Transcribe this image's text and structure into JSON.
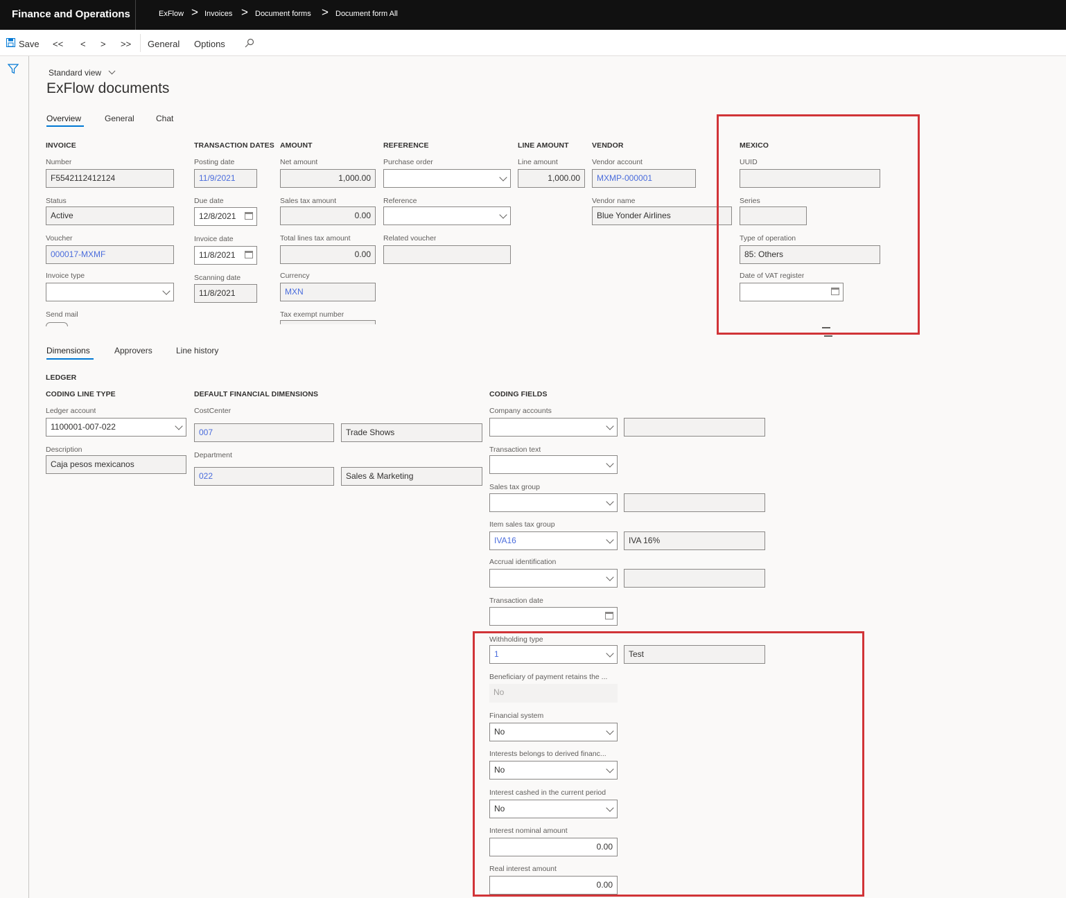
{
  "header": {
    "app_title": "Finance and Operations",
    "breadcrumbs": [
      "ExFlow",
      "Invoices",
      "Document forms",
      "Document form All"
    ],
    "breadcrumb_separator": ">"
  },
  "toolbar": {
    "save": "Save",
    "first": "<<",
    "prev": "<",
    "next": ">",
    "last": ">>",
    "general": "General",
    "options": "Options"
  },
  "page": {
    "view": "Standard view",
    "title": "ExFlow documents"
  },
  "top_tabs": [
    "Overview",
    "General",
    "Chat"
  ],
  "invoice": {
    "heading": "INVOICE",
    "number_label": "Number",
    "number": "F5542112412124",
    "status_label": "Status",
    "status": "Active",
    "voucher_label": "Voucher",
    "voucher": "000017-MXMF",
    "invoice_type_label": "Invoice type",
    "invoice_type": "",
    "send_mail_label": "Send mail"
  },
  "transaction_dates": {
    "heading": "TRANSACTION DATES",
    "posting_label": "Posting date",
    "posting": "11/9/2021",
    "due_label": "Due date",
    "due": "12/8/2021",
    "invoice_label": "Invoice date",
    "invoice": "11/8/2021",
    "scanning_label": "Scanning date",
    "scanning": "11/8/2021"
  },
  "amount": {
    "heading": "AMOUNT",
    "net_label": "Net amount",
    "net": "1,000.00",
    "sales_tax_label": "Sales tax amount",
    "sales_tax": "0.00",
    "total_lines_tax_label": "Total lines tax amount",
    "total_lines_tax": "0.00",
    "currency_label": "Currency",
    "currency": "MXN",
    "tax_exempt_label": "Tax exempt number"
  },
  "reference": {
    "heading": "REFERENCE",
    "po_label": "Purchase order",
    "po": "",
    "ref_label": "Reference",
    "ref": "",
    "related_label": "Related voucher",
    "related": ""
  },
  "line_amount": {
    "heading": "LINE AMOUNT",
    "label": "Line amount",
    "value": "1,000.00"
  },
  "vendor": {
    "heading": "VENDOR",
    "account_label": "Vendor account",
    "account": "MXMP-000001",
    "name_label": "Vendor name",
    "name": "Blue Yonder Airlines"
  },
  "mexico": {
    "heading": "MEXICO",
    "uuid_label": "UUID",
    "uuid": "",
    "series_label": "Series",
    "series": "",
    "type_op_label": "Type of operation",
    "type_op": "85: Others",
    "vat_date_label": "Date of VAT register",
    "vat_date": ""
  },
  "line_tabs": [
    "Dimensions",
    "Approvers",
    "Line history"
  ],
  "ledger": {
    "heading": "LEDGER",
    "coding_line_type": "CODING LINE TYPE",
    "account_label": "Ledger account",
    "account": "1100001-007-022",
    "desc_label": "Description",
    "desc": "Caja pesos mexicanos"
  },
  "dims": {
    "heading": "DEFAULT FINANCIAL DIMENSIONS",
    "cc_label": "CostCenter",
    "cc": "007",
    "cc_name": "Trade Shows",
    "dept_label": "Department",
    "dept": "022",
    "dept_name": "Sales & Marketing"
  },
  "coding": {
    "heading": "CODING FIELDS",
    "company_label": "Company accounts",
    "trans_text_label": "Transaction text",
    "stg_label": "Sales tax group",
    "istg_label": "Item sales tax group",
    "istg": "IVA16",
    "istg_name": "IVA 16%",
    "accrual_label": "Accrual identification",
    "trans_date_label": "Transaction date",
    "wh_type_label": "Withholding type",
    "wh_type": "1",
    "wh_type_name": "Test",
    "beneficiary_label": "Beneficiary of payment retains the ...",
    "beneficiary": "No",
    "fin_sys_label": "Financial system",
    "fin_sys": "No",
    "interests_derived_label": "Interests belongs to derived financ...",
    "interests_derived": "No",
    "interest_cashed_label": "Interest cashed in the current period",
    "interest_cashed": "No",
    "nominal_label": "Interest nominal amount",
    "nominal": "0.00",
    "real_label": "Real interest amount",
    "real": "0.00"
  },
  "colors": {
    "topbar": "#111111",
    "highlight": "#d13438",
    "link": "#4a6cdc",
    "accent": "#0078d4"
  }
}
